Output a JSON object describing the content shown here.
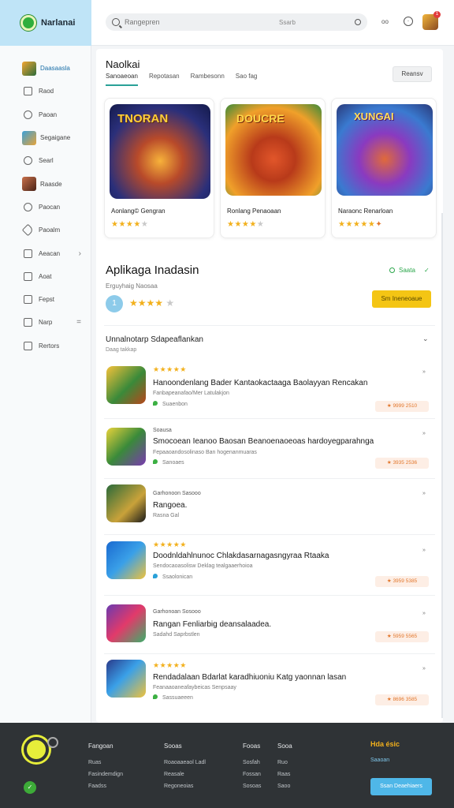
{
  "header": {
    "brand": "Narlanai",
    "search_placeholder": "Rangepren",
    "search_button": "Ssarb",
    "top_text": "oo",
    "badge_count": "1"
  },
  "sidebar": {
    "items": [
      {
        "label": "Daasaasla",
        "icon": "game-thumbnail-icon"
      },
      {
        "label": "Raod",
        "icon": "document-icon"
      },
      {
        "label": "Paoan",
        "icon": "heart-icon"
      },
      {
        "label": "Segaigane",
        "icon": "game-thumbnail-icon"
      },
      {
        "label": "Searl",
        "icon": "compass-icon"
      },
      {
        "label": "Raasde",
        "icon": "avatar-icon"
      },
      {
        "label": "Paocan",
        "icon": "circle-icon"
      },
      {
        "label": "Paoalm",
        "icon": "tag-icon"
      },
      {
        "label": "Aeacan",
        "icon": "folder-icon"
      },
      {
        "label": "Aoat",
        "icon": "box-icon"
      },
      {
        "label": "Fepst",
        "icon": "square-icon"
      },
      {
        "label": "Narp",
        "icon": "grid-icon"
      },
      {
        "label": "Rertors",
        "icon": "settings-icon"
      }
    ]
  },
  "main": {
    "title": "Naolkai",
    "tabs": [
      "Sanoaeoan",
      "Repotasan",
      "Rambesonn",
      "Sao fag"
    ],
    "filter_button": "Reansv",
    "featured": [
      {
        "name": "Aonlang© Gengran",
        "banner": "TNORAN",
        "stars": 4
      },
      {
        "name": "Ronlang Penaoaan",
        "banner": "DOUCRE",
        "stars": 4
      },
      {
        "name": "Naraonc Renarloan",
        "banner": "XUNGAI",
        "stars": 5
      }
    ],
    "section": {
      "title": "Aplikaga Inadasin",
      "subtitle": "Erguyhaig Naosaa",
      "badge": "1",
      "stars": 4,
      "status": "Saata",
      "check": "✓",
      "button": "Sm Ineneoaue"
    },
    "list": {
      "heading": "Unnalnotarp Sdapeaflankan",
      "subheading": "Daag takkap",
      "rows": [
        {
          "top": "★★★★★",
          "title": "Hanoondenlang Bader Kantaokactaaga Baolayyan Rencakan",
          "meta": "Fanbapeanafao/Mer Latulakjon",
          "foot": "Suaenbon",
          "dot": "#3cb043",
          "price": "★ 9999 2510"
        },
        {
          "top": "Soausa",
          "title": "Smocoean Ieanoo Baosan Beanoenaoeoas hardoyegparahnga",
          "meta": "Fepaaoandosolinaso Ban hogenanmuaras",
          "foot": "Sanoaes",
          "dot": "#3cb043",
          "price": "★ 3935 2536"
        },
        {
          "top": "Garhonoon Sasooo",
          "title": "Rangoea.",
          "meta": "Rasna Gal",
          "foot": "",
          "dot": "",
          "price": ""
        },
        {
          "top": "★★★★★",
          "title": "Doodnldahlnunoc Chlakdasarnagasngyraa Rtaaka",
          "meta": "Sendocaoasolisw Deklag tealgaaerhoioa",
          "foot": "Ssaolonican",
          "dot": "#2aa1d8",
          "price": "★ 3959 5385"
        },
        {
          "top": "Garhonoan Sosooo",
          "title": "Rangan Fenliarbig deansalaadea.",
          "meta": "Sadahd Saprbstlen",
          "foot": "",
          "dot": "",
          "price": "★ 5959 5565"
        },
        {
          "top": "★★★★★",
          "title": "Rendadalaan Bdarlat karadhiuoniu Katg yaonnan lasan",
          "meta": "Feanaaoaneafaybeicas Senpsaay",
          "foot": "Sassuaeeen",
          "dot": "#3cb043",
          "price": "★ 8696 3585"
        }
      ]
    }
  },
  "footer": {
    "columns": [
      {
        "heading": "Fangoan",
        "links": [
          "Ruas",
          "Fasindemdign",
          "Faadss"
        ]
      },
      {
        "heading": "Sooas",
        "links": [
          "Roaoaaeaol Ladl",
          "Reasale",
          "Regoneoias"
        ]
      },
      {
        "heading": "Fooas",
        "links": [
          "Sosfah",
          "Fossan",
          "Sosoas"
        ]
      },
      {
        "heading": "Sooa",
        "links": [
          "Ruo",
          "Raas",
          "Saoo"
        ]
      }
    ],
    "cta_title": "Hda ésic",
    "cta_subtitle": "Saaoan",
    "cta_button": "Ssan Deaehiaers",
    "badge": "✓"
  }
}
